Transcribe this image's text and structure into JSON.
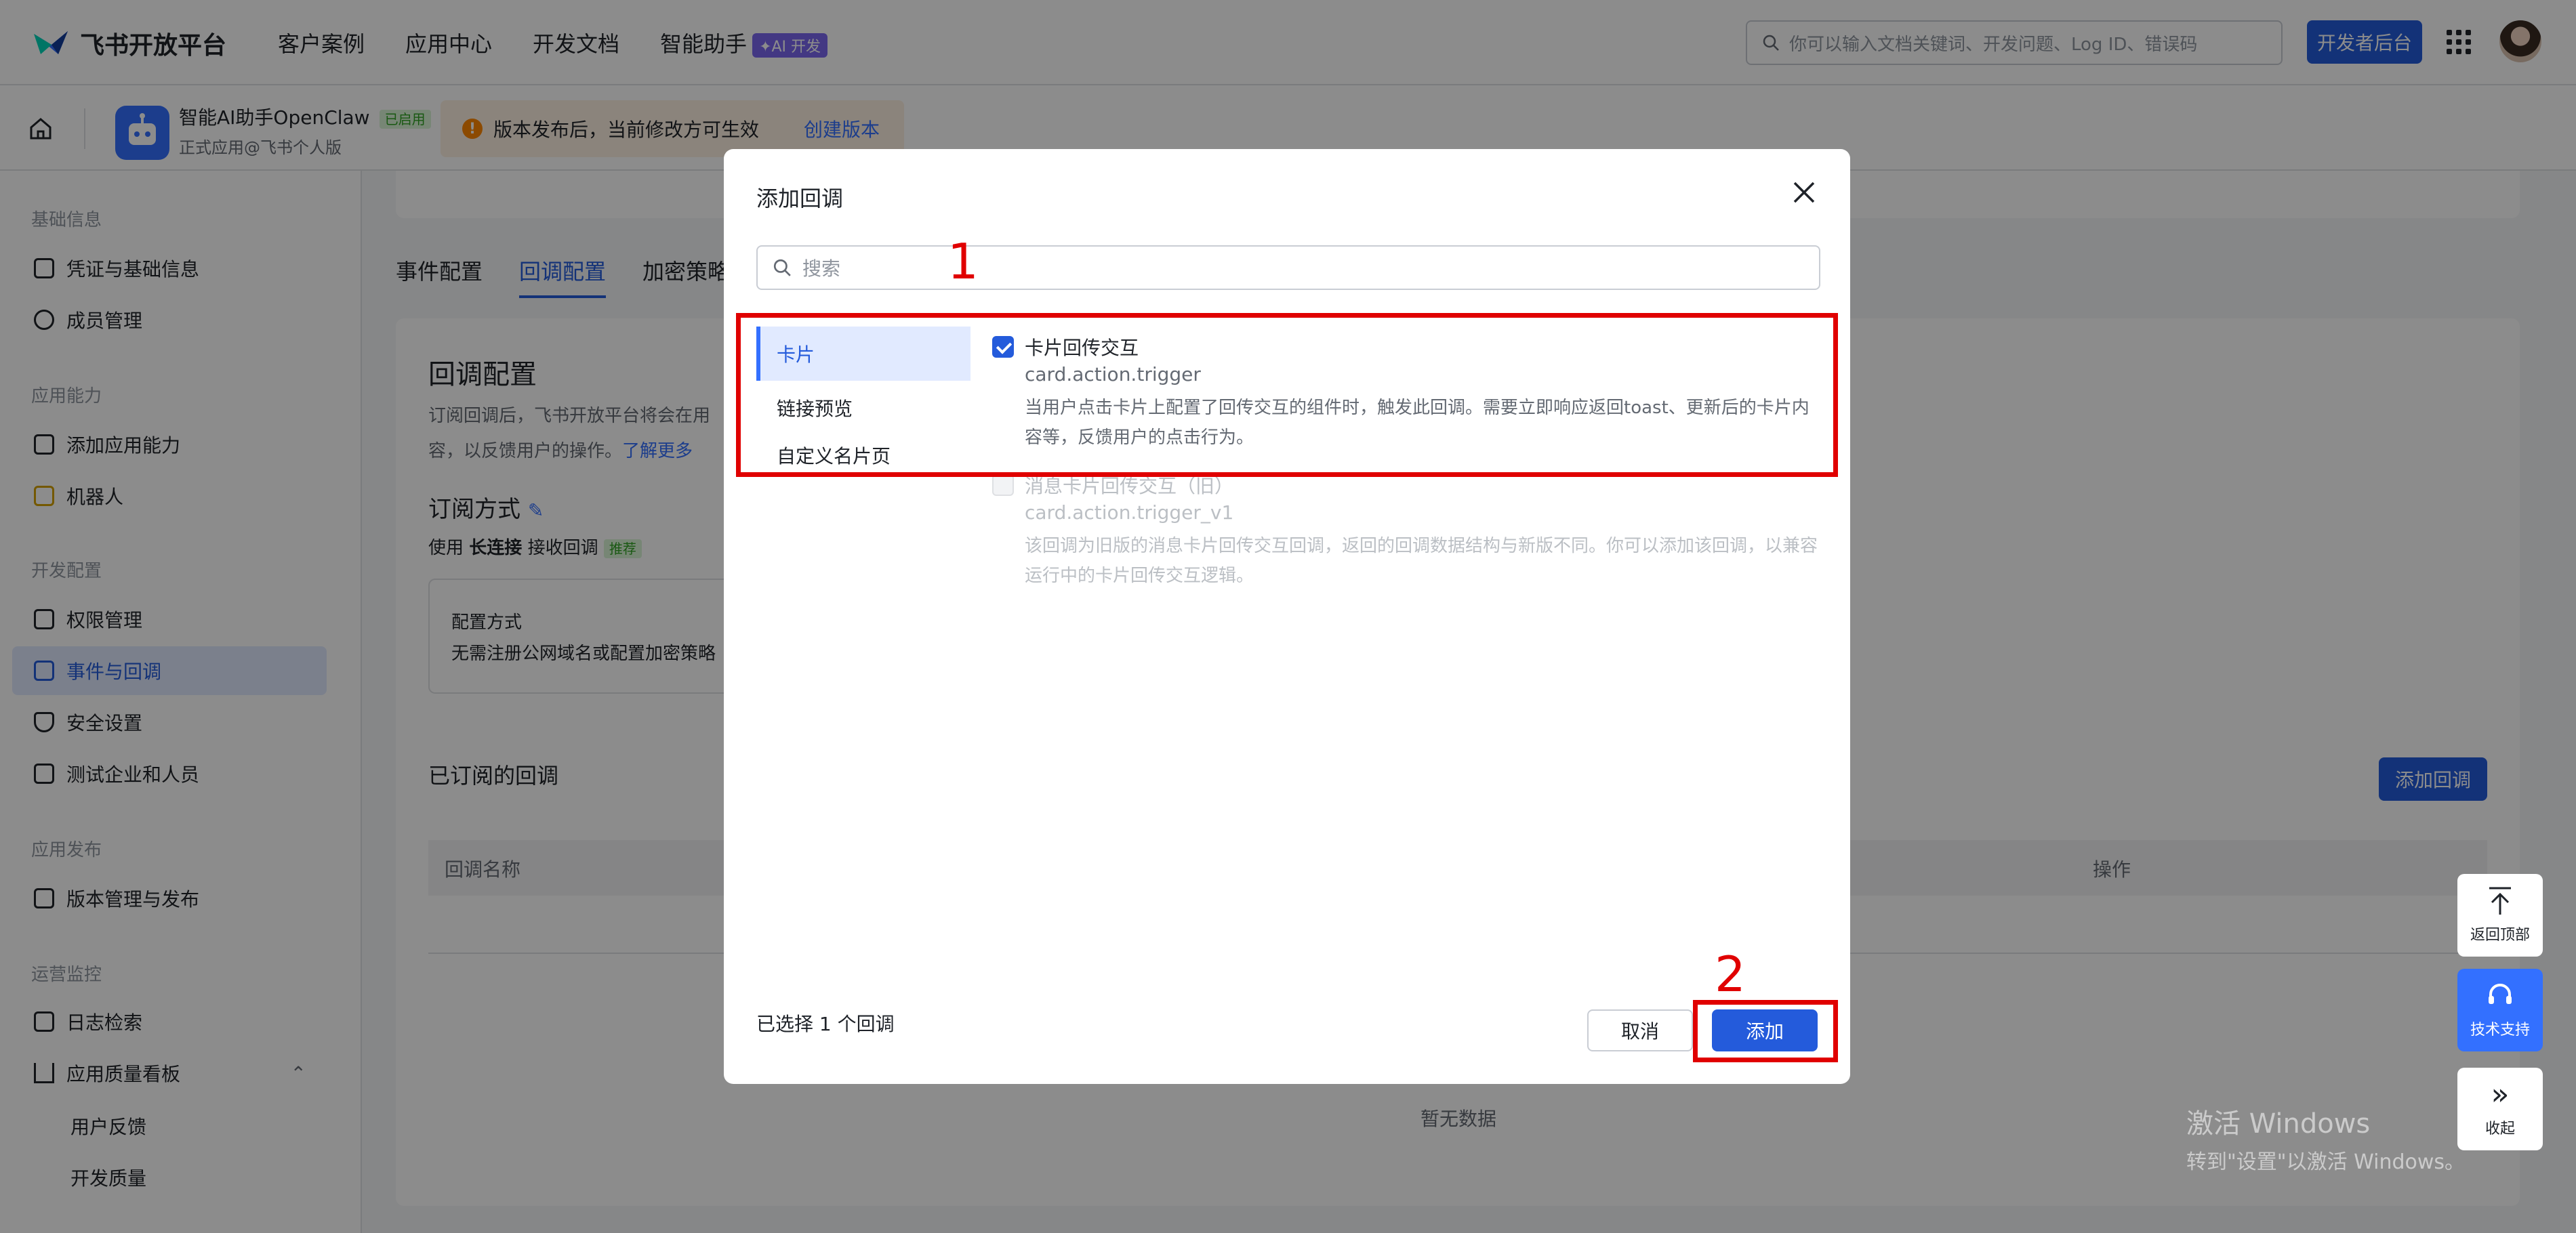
{
  "topnav": {
    "brand": "飞书开放平台",
    "links": [
      "客户案例",
      "应用中心",
      "开发文档",
      "智能助手"
    ],
    "ai_badge": "✦AI 开发",
    "search_placeholder": "你可以输入文档关键词、开发问题、Log ID、错误码",
    "dev_button": "开发者后台"
  },
  "subheader": {
    "app_name": "智能AI助手OpenClaw",
    "app_status": "已启用",
    "app_sub": "正式应用@飞书个人版",
    "notice_text": "版本发布后，当前修改方可生效",
    "notice_link": "创建版本"
  },
  "sidebar": {
    "group1": "基础信息",
    "item_credentials": "凭证与基础信息",
    "item_members": "成员管理",
    "group2": "应用能力",
    "item_add_capability": "添加应用能力",
    "item_bot": "机器人",
    "group3": "开发配置",
    "item_permissions": "权限管理",
    "item_events": "事件与回调",
    "item_security": "安全设置",
    "item_test": "测试企业和人员",
    "group4": "应用发布",
    "item_versions": "版本管理与发布",
    "group5": "运营监控",
    "item_logs": "日志检索",
    "item_quality": "应用质量看板",
    "sub_feedback": "用户反馈",
    "sub_dev_quality": "开发质量"
  },
  "main": {
    "tabs": [
      "事件配置",
      "回调配置",
      "加密策略"
    ],
    "title": "回调配置",
    "desc": "订阅回调后，飞书开放平台将会在用容，以反馈用户的操作。",
    "learn_more": "了解更多",
    "subscribe_title": "订阅方式",
    "conn_prefix": "使用",
    "conn_bold": "长连接",
    "conn_suffix": "接收回调",
    "conn_recommended": "推荐",
    "config_label": "配置方式",
    "config_value": "无需注册公网域名或配置加密策略",
    "subscribed_title": "已订阅的回调",
    "add_callback_button": "添加回调",
    "col_name": "回调名称",
    "col_action": "操作",
    "empty": "暂无数据"
  },
  "float": {
    "back_top": "返回顶部",
    "support": "技术支持",
    "collapse": "收起"
  },
  "watermark": {
    "line1": "激活 Windows",
    "line2": "转到\"设置\"以激活 Windows。"
  },
  "modal": {
    "title": "添加回调",
    "search_placeholder": "搜索",
    "categories": [
      "卡片",
      "链接预览",
      "自定义名片页"
    ],
    "option1": {
      "title": "卡片回传交互",
      "key": "card.action.trigger",
      "desc": "当用户点击卡片上配置了回传交互的组件时，触发此回调。需要立即响应返回toast、更新后的卡片内容等，反馈用户的点击行为。"
    },
    "option2": {
      "title": "消息卡片回传交互（旧）",
      "key": "card.action.trigger_v1",
      "desc": "该回调为旧版的消息卡片回传交互回调，返回的回调数据结构与新版不同。你可以添加该回调，以兼容运行中的卡片回传交互逻辑。"
    },
    "selected_text": "已选择 1 个回调",
    "cancel": "取消",
    "add": "添加"
  },
  "annotations": {
    "num1": "1",
    "num2": "2"
  },
  "colors": {
    "brand_blue": "#245bdb",
    "annotation_red": "#e00000"
  }
}
